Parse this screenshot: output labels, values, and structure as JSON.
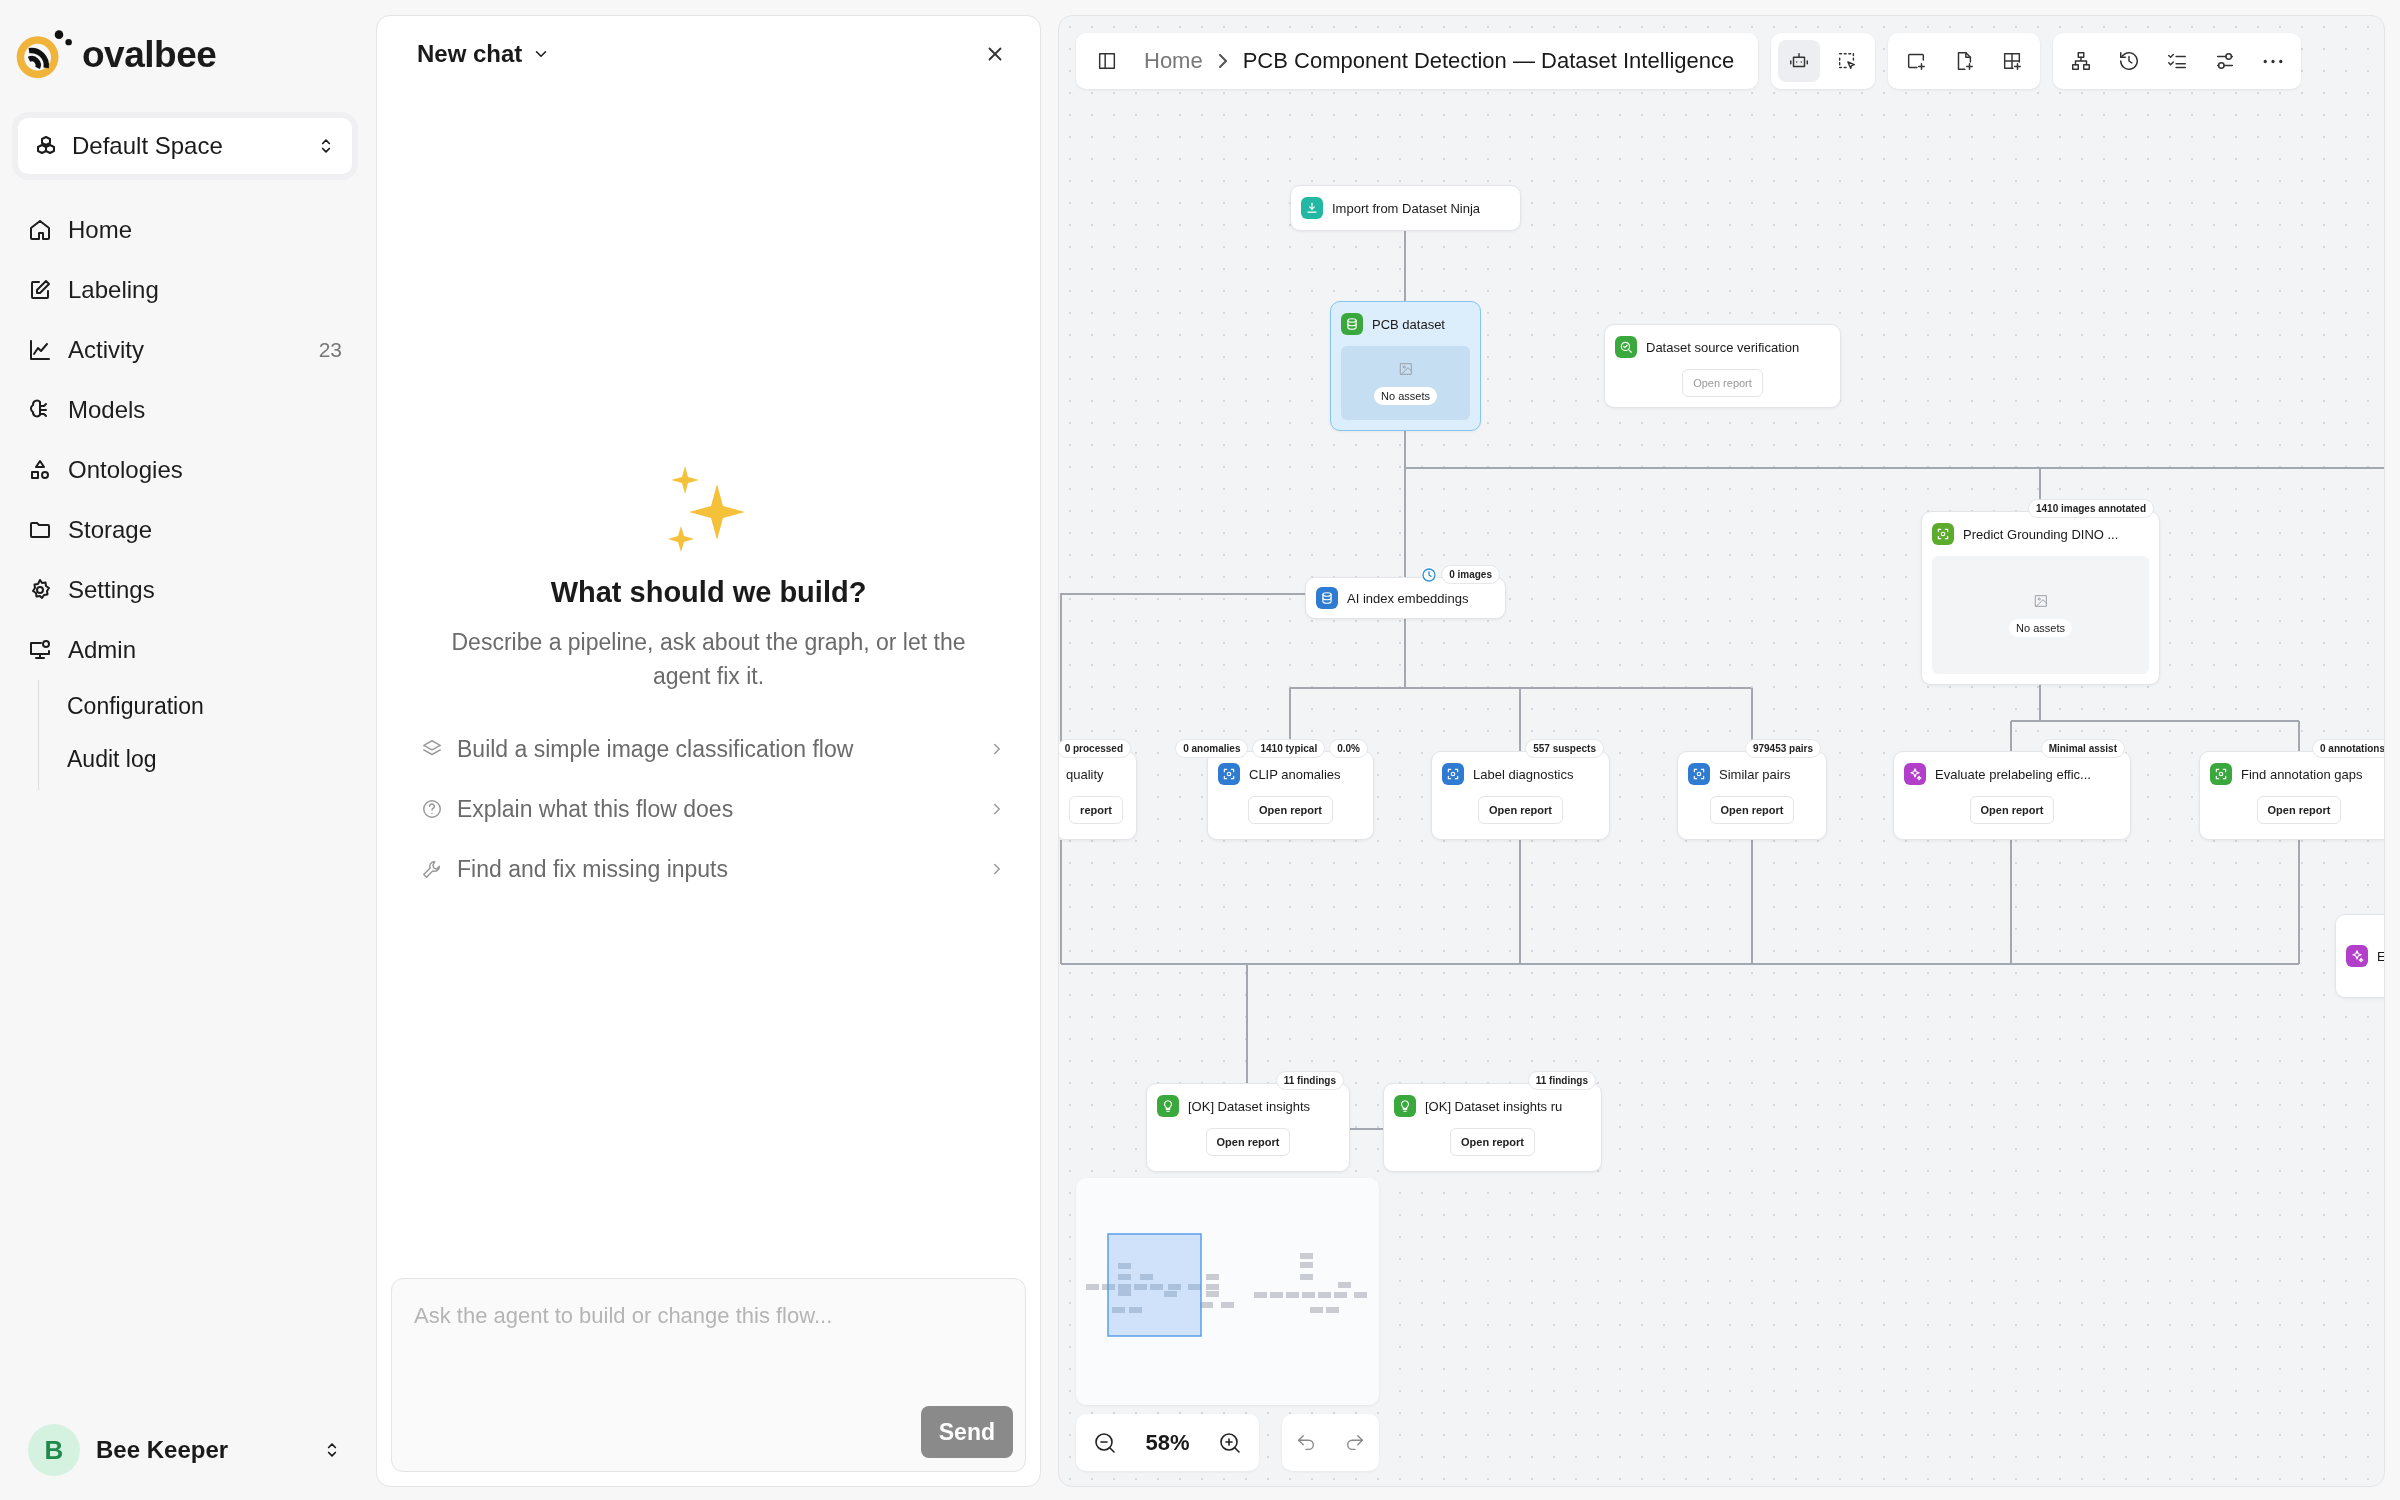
{
  "brand": {
    "name": "ovalbee"
  },
  "space_selector": {
    "label": "Default Space"
  },
  "sidebar": {
    "items": [
      {
        "label": "Home"
      },
      {
        "label": "Labeling"
      },
      {
        "label": "Activity",
        "count": "23"
      },
      {
        "label": "Models"
      },
      {
        "label": "Ontologies"
      },
      {
        "label": "Storage"
      },
      {
        "label": "Settings"
      },
      {
        "label": "Admin",
        "children": [
          {
            "label": "Configuration"
          },
          {
            "label": "Audit log"
          }
        ]
      }
    ]
  },
  "user": {
    "initial": "B",
    "name": "Bee Keeper"
  },
  "chat": {
    "title": "New chat",
    "heading": "What should we build?",
    "description": "Describe a pipeline, ask about the graph, or let the agent fix it.",
    "suggestions": [
      {
        "label": "Build a simple image classification flow"
      },
      {
        "label": "Explain what this flow does"
      },
      {
        "label": "Find and fix missing inputs"
      }
    ],
    "input": {
      "placeholder": "Ask the agent to build or change this flow..."
    },
    "send_button": "Send"
  },
  "toolbar": {
    "breadcrumb": [
      "Home",
      "PCB Component Detection — Dataset Intelligence"
    ],
    "agent_chat_active": true
  },
  "nodes": [
    {
      "title": "Import from Dataset Ninja",
      "kind": "step",
      "color": "#22b8a4",
      "selected": false
    },
    {
      "title": "PCB dataset",
      "kind": "preview",
      "color": "#3aa83c",
      "selected": true,
      "preview_label": "No assets"
    },
    {
      "title": "Dataset source verification",
      "kind": "report",
      "color": "#3aa83c",
      "selected": false,
      "action": {
        "label": "Open report",
        "disabled": true
      }
    },
    {
      "title": "Predict Grounding DINO ...",
      "kind": "preview",
      "color": "#5cab2c",
      "selected": false,
      "badges": [
        "1410 images annotated"
      ],
      "preview_label": "No assets"
    },
    {
      "title": "AI index embeddings",
      "kind": "step",
      "color": "#2e7bd1",
      "selected": false,
      "badges": [
        "0 images"
      ]
    },
    {
      "title": "quality",
      "kind": "report",
      "selected": false,
      "badges": [
        "0 processed"
      ],
      "action": {
        "label": "report",
        "disabled": false
      }
    },
    {
      "title": "CLIP anomalies",
      "kind": "report",
      "color": "#2e7bd1",
      "selected": false,
      "badges": [
        "0 anomalies",
        "1410 typical",
        "0.0%"
      ],
      "action": {
        "label": "Open report",
        "disabled": false
      }
    },
    {
      "title": "Label diagnostics",
      "kind": "report",
      "color": "#2e7bd1",
      "selected": false,
      "badges": [
        "557 suspects"
      ],
      "action": {
        "label": "Open report",
        "disabled": false
      }
    },
    {
      "title": "Similar pairs",
      "kind": "report",
      "color": "#2e7bd1",
      "selected": false,
      "badges": [
        "979453 pairs"
      ],
      "action": {
        "label": "Open report",
        "disabled": false
      }
    },
    {
      "title": "Evaluate prelabeling effic...",
      "kind": "report",
      "color": "#b23fc9",
      "selected": false,
      "badges": [
        "Minimal assist"
      ],
      "action": {
        "label": "Open report",
        "disabled": false
      }
    },
    {
      "title": "Find annotation gaps",
      "kind": "report",
      "color": "#3aa83c",
      "selected": false,
      "badges": [
        "0 annotations"
      ],
      "action": {
        "label": "Open report",
        "disabled": false
      }
    },
    {
      "title": "E",
      "kind": "step",
      "color": "#b23fc9",
      "selected": false
    },
    {
      "title": "[OK] Dataset insights",
      "kind": "report",
      "color": "#3aa83c",
      "selected": false,
      "badges": [
        "11 findings"
      ],
      "action": {
        "label": "Open report",
        "disabled": false
      }
    },
    {
      "title": "[OK] Dataset insights ru",
      "kind": "report",
      "color": "#3aa83c",
      "selected": false,
      "badges": [
        "11 findings"
      ],
      "action": {
        "label": "Open report",
        "disabled": false
      }
    }
  ],
  "zoom": {
    "value": "58%"
  }
}
